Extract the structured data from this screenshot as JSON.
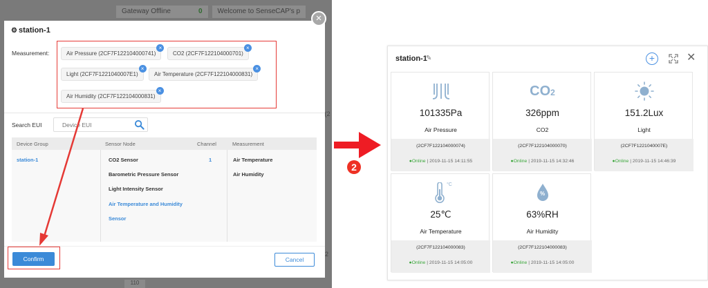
{
  "background_app": {
    "gateway_label": "Gateway Offline",
    "gateway_count": "0",
    "welcome_text": "Welcome to SenseCAP's p",
    "side_text": "2 (2",
    "side_text_2": "t (2",
    "bottom_text": "110"
  },
  "modal": {
    "close_label": "×",
    "title": "station-1",
    "measurement_label": "Measurement:",
    "tags": [
      {
        "label": "Air Pressure (2CF7F122104000741)",
        "remove": "×"
      },
      {
        "label": "CO2 (2CF7F122104000701)",
        "remove": "×"
      },
      {
        "label": "Light (2CF7F1221040007E1)",
        "remove": "×"
      },
      {
        "label": "Air Temperature (2CF7F122104000831)",
        "remove": "×"
      },
      {
        "label": "Air Humidity (2CF7F122104000831)",
        "remove": "×"
      }
    ],
    "search_label": "Search EUI",
    "search_placeholder": "Device EUI",
    "table": {
      "headers": [
        "Device Group",
        "Sensor Node",
        "Channel",
        "Measurement"
      ],
      "device_group": "station-1",
      "sensor_nodes": [
        "CO2 Sensor",
        "Barometric Pressure Sensor",
        "Light Intensity Sensor",
        "Air Temperature and Humidity",
        "Sensor"
      ],
      "channel": "1",
      "measurements": [
        "Air Temperature",
        "Air Humidity"
      ]
    },
    "confirm_label": "Confirm",
    "cancel_label": "Cancel"
  },
  "step_badge": "2",
  "accent_colors": {
    "primary": "#3b8ad8",
    "highlight": "#e53935",
    "online": "#3aa53a"
  },
  "panel": {
    "title": "station-1",
    "add_label": "+",
    "close_label": "✕",
    "cards": [
      {
        "icon": "pressure-icon",
        "value": "101335Pa",
        "name": "Air Pressure",
        "eui": "(2CF7F122104000074)",
        "status": "Online",
        "time": "| 2019-11-15 14:11:55"
      },
      {
        "icon": "co2-icon",
        "icon_text": "CO",
        "icon_sub": "2",
        "value": "326ppm",
        "name": "CO2",
        "eui": "(2CF7F122104000070)",
        "status": "Online",
        "time": "| 2019-11-15 14:32:46"
      },
      {
        "icon": "sun-icon",
        "value": "151.2Lux",
        "name": "Light",
        "eui": "(2CF7F1221040007E)",
        "status": "Online",
        "time": "| 2019-11-15 14:46:39"
      },
      {
        "icon": "thermometer-icon",
        "icon_unit": "°C",
        "value": "25℃",
        "name": "Air Temperature",
        "eui": "(2CF7F122104000083)",
        "status": "Online",
        "time": "| 2019-11-15 14:05:00"
      },
      {
        "icon": "humidity-drop-icon",
        "icon_text": "%",
        "value": "63%RH",
        "name": "Air Humidity",
        "eui": "(2CF7F122104000083)",
        "status": "Online",
        "time": "| 2019-11-15 14:05:00"
      }
    ]
  }
}
